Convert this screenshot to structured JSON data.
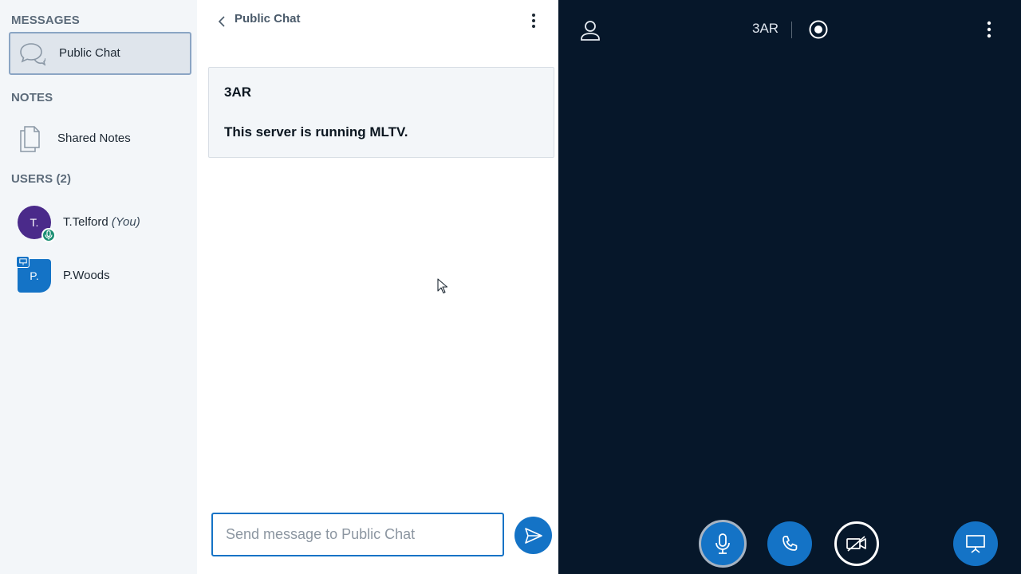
{
  "sidebar": {
    "messages_title": "MESSAGES",
    "public_chat_label": "Public Chat",
    "notes_title": "NOTES",
    "shared_notes_label": "Shared Notes",
    "users_title": "USERS (2)",
    "users": [
      {
        "initials": "T.",
        "name": "T.Telford",
        "suffix": "(You)"
      },
      {
        "initials": "P.",
        "name": "P.Woods",
        "suffix": ""
      }
    ]
  },
  "chat": {
    "title": "Public Chat",
    "welcome_line1": "3AR",
    "welcome_line2": "This server is running MLTV.",
    "input_placeholder": "Send message to Public Chat"
  },
  "main": {
    "meeting_name": "3AR",
    "controls": [
      "microphone-icon",
      "phone-icon",
      "camera-off-icon",
      "presentation-icon"
    ]
  },
  "colors": {
    "accent": "#1473c6",
    "dark_bg": "#06172a",
    "sidebar_bg": "#f3f6f9",
    "talking_badge": "#1a8e73",
    "avatar_purple": "#4a2a8a"
  }
}
